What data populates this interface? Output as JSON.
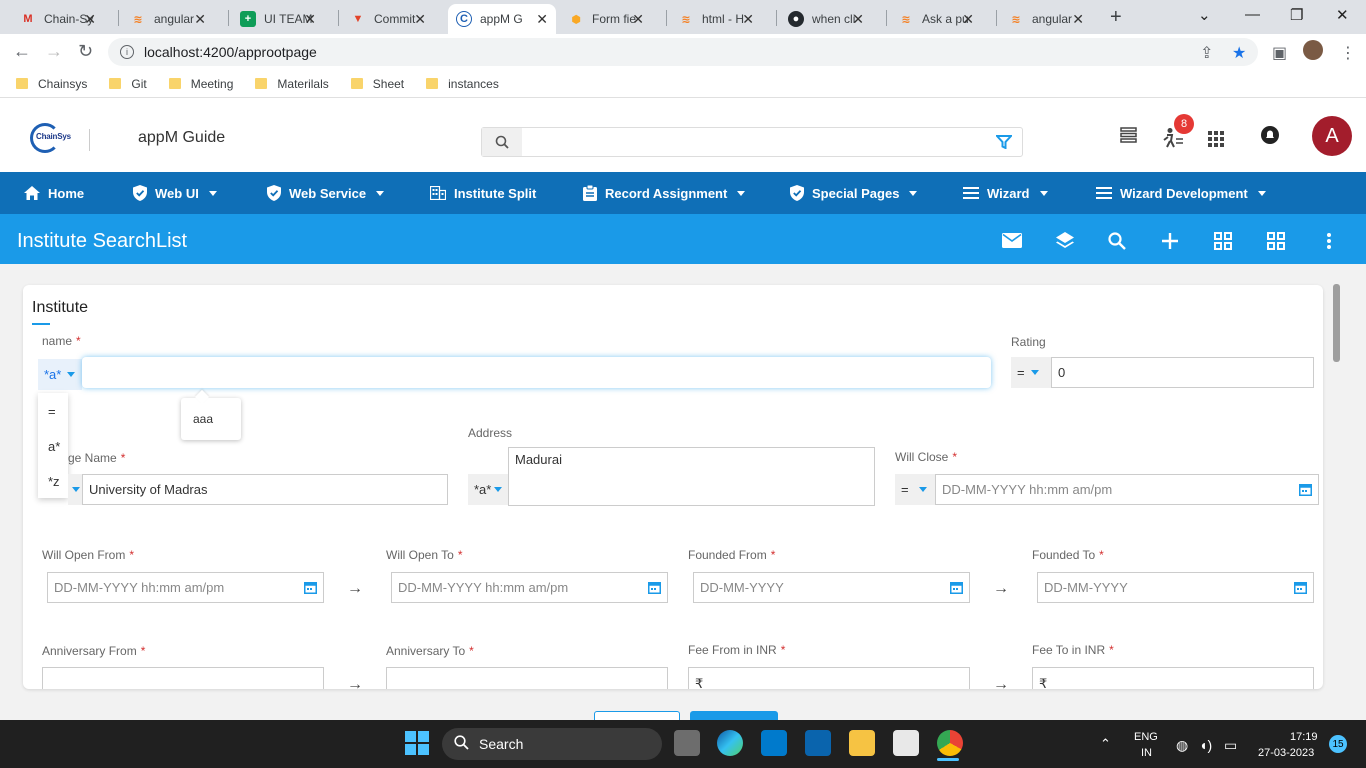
{
  "browser": {
    "tabs": [
      {
        "title": "Chain-Sy",
        "icon": "gmail-icon",
        "color": "#d93025"
      },
      {
        "title": "angular",
        "icon": "stackoverflow-icon",
        "color": "#f48024"
      },
      {
        "title": "UI TEAM",
        "icon": "sheets-icon",
        "color": "#0f9d58"
      },
      {
        "title": "Commit",
        "icon": "gitlab-icon",
        "color": "#e24329"
      },
      {
        "title": "appM G",
        "icon": "chainsys-icon",
        "color": "#1e5fb3"
      },
      {
        "title": "Form fie",
        "icon": "shield-tab-icon",
        "color": "#f9a825"
      },
      {
        "title": "html - H",
        "icon": "stackoverflow-icon",
        "color": "#f48024"
      },
      {
        "title": "when cli",
        "icon": "github-icon",
        "color": "#24292e"
      },
      {
        "title": "Ask a pu",
        "icon": "stackoverflow-icon",
        "color": "#f48024"
      },
      {
        "title": "angular",
        "icon": "stackoverflow-icon",
        "color": "#f48024"
      }
    ],
    "url": "localhost:4200/approotpage",
    "bookmarks": [
      "Chainsys",
      "Git",
      "Meeting",
      "Materilals",
      "Sheet",
      "instances"
    ]
  },
  "app": {
    "title": "appM Guide",
    "logo_text": "ChainSys",
    "notification_count": "8",
    "avatar_letter": "A",
    "colors": {
      "nav": "#0f6fb7",
      "titlebar": "#1a9ae8",
      "avatar": "#a31d2c"
    }
  },
  "nav": [
    {
      "label": "Home",
      "icon": "home-icon"
    },
    {
      "label": "Web UI",
      "icon": "shield-icon"
    },
    {
      "label": "Web Service",
      "icon": "shield-icon"
    },
    {
      "label": "Institute Split",
      "icon": "building-icon"
    },
    {
      "label": "Record Assignment",
      "icon": "clipboard-icon"
    },
    {
      "label": "Special Pages",
      "icon": "shield-icon"
    },
    {
      "label": "Wizard",
      "icon": "menu-icon"
    },
    {
      "label": "Wizard Development",
      "icon": "menu-icon"
    }
  ],
  "page": {
    "title": "Institute SearchList",
    "card_title": "Institute"
  },
  "form": {
    "name": {
      "label": "name",
      "operator": "*a*",
      "value": ""
    },
    "operator_options": [
      "=",
      "a*",
      "*z"
    ],
    "suggestion": "aaa",
    "rating": {
      "label": "Rating",
      "operator": "=",
      "value": "0"
    },
    "college": {
      "label": "ge Name",
      "value": "University of Madras"
    },
    "address": {
      "label": "Address",
      "operator": "*a*",
      "value": "Madurai"
    },
    "will_close": {
      "label": "Will Close",
      "operator": "=",
      "placeholder": "DD-MM-YYYY hh:mm am/pm"
    },
    "will_open_from": {
      "label": "Will Open From",
      "placeholder": "DD-MM-YYYY hh:mm am/pm"
    },
    "will_open_to": {
      "label": "Will Open To",
      "placeholder": "DD-MM-YYYY hh:mm am/pm"
    },
    "founded_from": {
      "label": "Founded From",
      "placeholder": "DD-MM-YYYY"
    },
    "founded_to": {
      "label": "Founded To",
      "placeholder": "DD-MM-YYYY"
    },
    "anniversary_from": {
      "label": "Anniversary From"
    },
    "anniversary_to": {
      "label": "Anniversary To"
    },
    "fee_from": {
      "label": "Fee From in INR",
      "prefix": "₹"
    },
    "fee_to": {
      "label": "Fee To in INR",
      "prefix": "₹"
    },
    "required_mark": "*"
  },
  "taskbar": {
    "search": "Search",
    "lang1": "ENG",
    "lang2": "IN",
    "time": "17:19",
    "date": "27-03-2023",
    "notifications": "15"
  }
}
